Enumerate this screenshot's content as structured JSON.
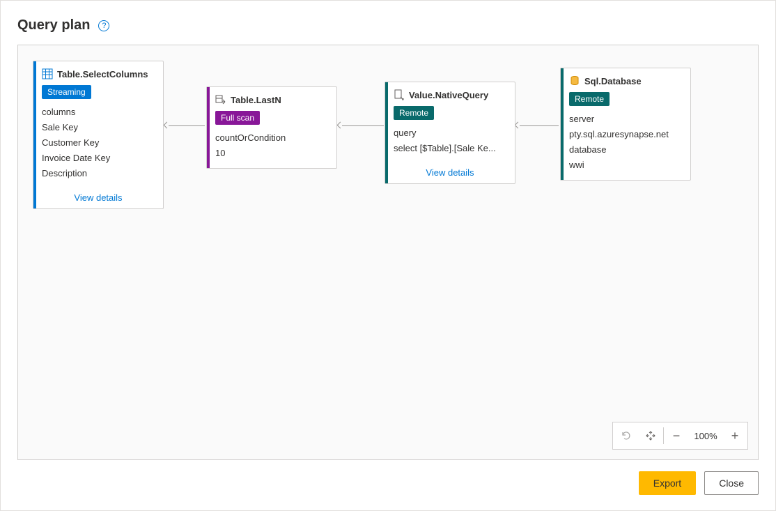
{
  "header": {
    "title": "Query plan"
  },
  "nodes": {
    "selectColumns": {
      "title": "Table.SelectColumns",
      "badge": "Streaming",
      "rows": [
        "columns",
        "Sale Key",
        "Customer Key",
        "Invoice Date Key",
        "Description"
      ],
      "viewDetails": "View details"
    },
    "lastN": {
      "title": "Table.LastN",
      "badge": "Full scan",
      "rows": [
        "countOrCondition",
        "10"
      ]
    },
    "nativeQuery": {
      "title": "Value.NativeQuery",
      "badge": "Remote",
      "rows": [
        "query",
        "select [$Table].[Sale Ke..."
      ],
      "viewDetails": "View details"
    },
    "sqlDatabase": {
      "title": "Sql.Database",
      "badge": "Remote",
      "rows": [
        "server",
        "pty.sql.azuresynapse.net",
        "database",
        "wwi"
      ]
    }
  },
  "zoom": {
    "value": "100%"
  },
  "footer": {
    "export": "Export",
    "close": "Close"
  }
}
